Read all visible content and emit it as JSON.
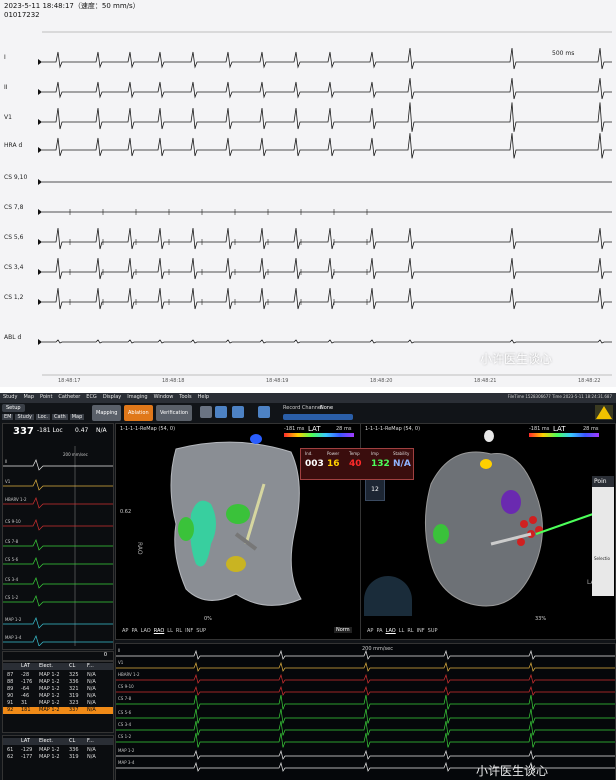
{
  "paper": {
    "header_line1": "2023-5-11 18:48:17（速度：50 mm/s）",
    "header_line2": "01017232",
    "scale_label": "500 ms",
    "channels": [
      "I",
      "II",
      "V1",
      "HRA d",
      "CS 9,10",
      "CS 7,8",
      "CS 5,6",
      "CS 3,4",
      "CS 1,2",
      "ABL d"
    ],
    "time_ticks": [
      "18:48:17",
      "18:48:18",
      "18:48:19",
      "18:48:20",
      "18:48:21",
      "18:48:22"
    ],
    "watermark": "小许医生谈心"
  },
  "system": {
    "menu": [
      "Study",
      "Map",
      "Point",
      "Catheter",
      "ECG",
      "Display",
      "Imaging",
      "Window",
      "Tools",
      "Help"
    ],
    "tabs": [
      "Setup",
      "Mapping",
      "Ablation",
      "Verification"
    ],
    "subtabs": [
      "EM",
      "Study",
      "Loc.",
      "Cath",
      "Map"
    ],
    "record_label": "Record Channel",
    "record_value": "None",
    "time_info": "FileTime 1528306677 Time 2023-5-11 18:24:31.687",
    "left_panel": {
      "big_value": "337",
      "loc": "-181 Loc",
      "v1": "0.47",
      "na": "N/A",
      "sub_labels": [
        "CL  LAT (ms)",
        "(ms)",
        "(mV)",
        "μA"
      ],
      "speed": "200 mm/sec",
      "channels": [
        "II",
        "V1",
        "HBARV 1-2",
        "CS 9-10",
        "CS 7-8",
        "CS 5-6",
        "CS 3-4",
        "CS 1-2",
        "MAP 1-2",
        "MAP 3-4"
      ],
      "counter": "0"
    },
    "table": {
      "headers": [
        "",
        "LAT",
        "Elect.",
        "CL",
        "F..."
      ],
      "rows": [
        [
          "87",
          "-28",
          "MAP 1-2",
          "325",
          "N/A"
        ],
        [
          "88",
          "-176",
          "MAP 1-2",
          "336",
          "N/A"
        ],
        [
          "89",
          "-64",
          "MAP 1-2",
          "321",
          "N/A"
        ],
        [
          "90",
          "-46",
          "MAP 1-2",
          "319",
          "N/A"
        ],
        [
          "91",
          "31",
          "MAP 1-2",
          "323",
          "N/A"
        ],
        [
          "92",
          "181",
          "MAP 1-2",
          "337",
          "N/A"
        ]
      ],
      "rows2": [
        [
          "61",
          "-129",
          "MAP 1-2",
          "336",
          "N/A"
        ],
        [
          "62",
          "-177",
          "MAP 1-2",
          "319",
          "N/A"
        ]
      ]
    },
    "map_left": {
      "title": "1-1-1-1-ReMap (54, 0)",
      "lat_min": "-181 ms",
      "lat_label": "LAT",
      "lat_max": "28 ms",
      "view": "RAO",
      "scale": "0.62",
      "zoom": "0%",
      "views": [
        "AP",
        "PA",
        "LAO",
        "RAO",
        "LL",
        "RL",
        "INF",
        "SUP"
      ],
      "norm": "Norm"
    },
    "map_right": {
      "title": "1-1-1-1-ReMap (54, 0)",
      "lat_min": "-181 ms",
      "lat_label": "LAT",
      "lat_max": "28 ms",
      "view": "LAO",
      "zoom": "33%",
      "views": [
        "AP",
        "PA",
        "LAO",
        "LL",
        "RL",
        "INF",
        "SUP"
      ],
      "select_label": "Selectio",
      "points_label": "Poin"
    },
    "ablation": {
      "labels": [
        "Ind.",
        "Power",
        "Temp",
        "Imp",
        "Stability"
      ],
      "values": [
        "003",
        "16",
        "40",
        "132",
        "N/A"
      ],
      "colors": [
        "#ffffff",
        "#ffd000",
        "#ff2a2a",
        "#4cff5a",
        "#8fb3ff"
      ]
    },
    "catheter_box": "12",
    "egm_speed": "200 mm/sec",
    "egm_channels": [
      "II",
      "V1",
      "HBARV 1-2",
      "CS 9-10",
      "CS 7-8",
      "CS 5-6",
      "CS 3-4",
      "CS 1-2",
      "MAP 1-2",
      "MAP 3-4"
    ],
    "watermark": "小许医生谈心"
  }
}
